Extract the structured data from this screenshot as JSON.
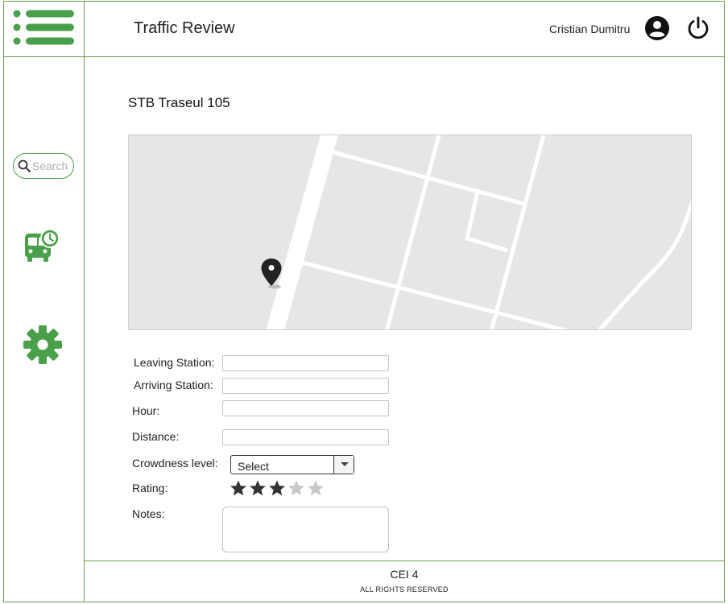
{
  "header": {
    "title": "Traffic Review",
    "user_name": "Cristian Dumitru",
    "menu_icon": "hamburger-menu-icon",
    "avatar_icon": "user-account-icon",
    "logout_icon": "power-icon"
  },
  "sidebar": {
    "search_placeholder": "Search",
    "items": [
      {
        "icon": "bus-schedule-icon"
      },
      {
        "icon": "gear-icon"
      }
    ]
  },
  "main": {
    "route_title": "STB Traseul 105",
    "map": {
      "marker_icon": "map-pin-icon"
    },
    "form": {
      "leaving_label": "Leaving Station:",
      "leaving_value": "",
      "arriving_label": "Arriving Station:",
      "arriving_value": "",
      "hour_label": "Hour:",
      "hour_value": "",
      "distance_label": "Distance:",
      "distance_value": "",
      "crowdness_label": "Crowdness level:",
      "crowdness_selected": "Select",
      "rating_label": "Rating:",
      "rating_value": 3,
      "rating_max": 5,
      "notes_label": "Notes:",
      "notes_value": ""
    }
  },
  "footer": {
    "title": "CEI 4",
    "subtitle": "ALL RIGHTS RESERVED"
  },
  "colors": {
    "accent_green": "#4aa04a",
    "border_green": "#6a9a4a",
    "map_bg": "#e6e6e6",
    "star_filled": "#333333",
    "star_empty": "#c8c8c8"
  }
}
